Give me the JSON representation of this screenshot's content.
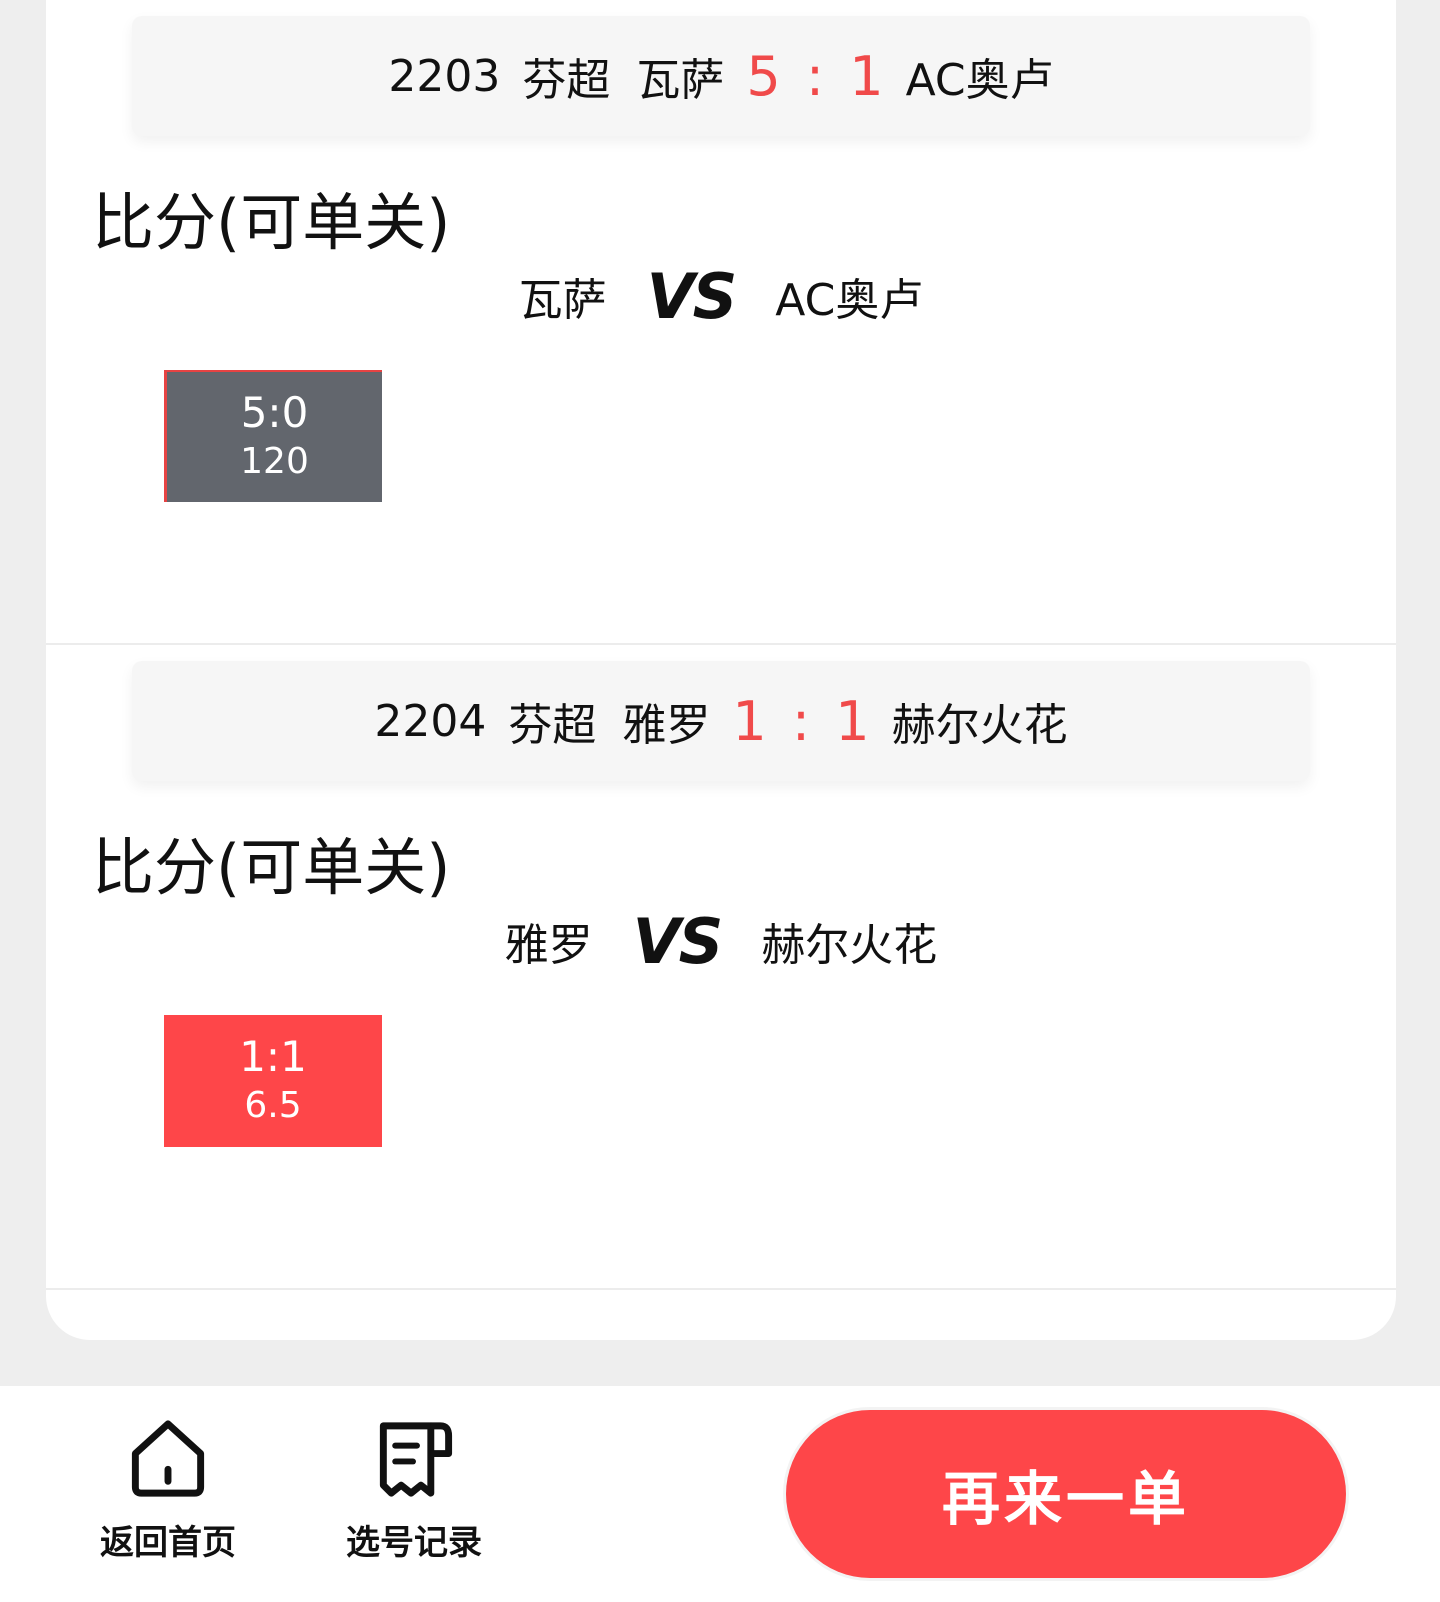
{
  "matches": [
    {
      "number": "2203",
      "league": "芬超",
      "home": "瓦萨",
      "score": "5 : 1",
      "away": "AC奥卢",
      "section_title": "比分(可单关)",
      "vs_label": "VS",
      "selection": {
        "score": "5:0",
        "odds": "120",
        "style": "gray"
      }
    },
    {
      "number": "2204",
      "league": "芬超",
      "home": "雅罗",
      "score": "1 : 1",
      "away": "赫尔火花",
      "section_title": "比分(可单关)",
      "vs_label": "VS",
      "selection": {
        "score": "1:1",
        "odds": "6.5",
        "style": "red"
      }
    }
  ],
  "bottom_bar": {
    "home_label": "返回首页",
    "home_icon": "home-icon",
    "record_label": "选号记录",
    "record_icon": "receipt-icon",
    "again_label": "再来一单"
  },
  "colors": {
    "accent_red": "#fe4649",
    "score_red": "#f04a4a",
    "selected_gray": "#62666d",
    "background": "#eeeeee"
  }
}
